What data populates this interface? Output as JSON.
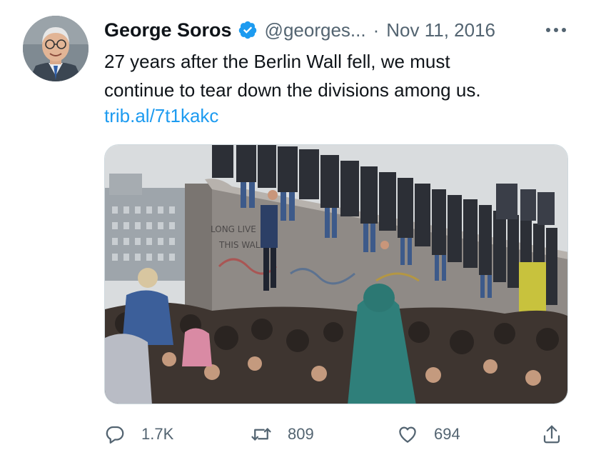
{
  "tweet": {
    "author": {
      "display_name": "George Soros",
      "verified_icon": "verified-badge-icon",
      "handle": "@georges...",
      "separator": "·",
      "date": "Nov 11, 2016"
    },
    "text_lines": [
      "27 years after the Berlin Wall fell, we must",
      "continue to tear down the divisions among us."
    ],
    "link": "trib.al/7t1kakc",
    "media": {
      "description_icon": "photo-berlin-wall",
      "wall_graffiti": [
        "LONG LIVE",
        "THIS WALL"
      ]
    },
    "actions": {
      "reply": {
        "icon": "reply-icon",
        "count": "1.7K"
      },
      "retweet": {
        "icon": "retweet-icon",
        "count": "809"
      },
      "like": {
        "icon": "like-icon",
        "count": "694"
      },
      "share": {
        "icon": "share-icon"
      }
    }
  },
  "colors": {
    "text": "#0f1419",
    "secondary": "#536471",
    "link": "#1d9bf0",
    "verified": "#1d9bf0"
  }
}
